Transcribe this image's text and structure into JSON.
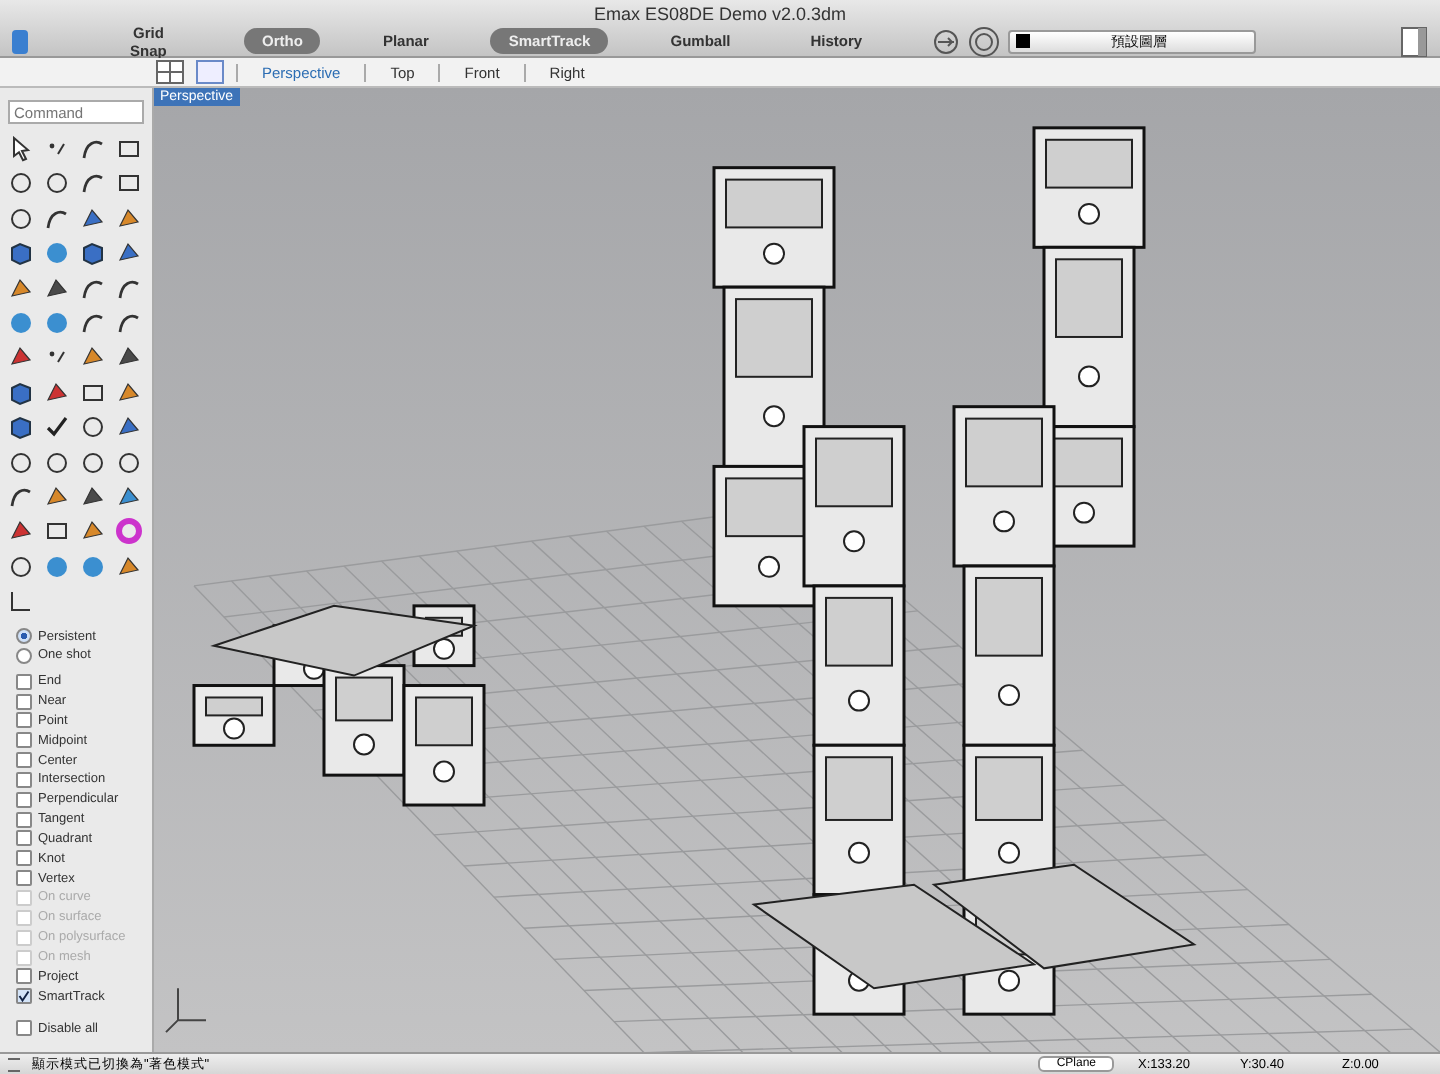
{
  "window": {
    "title": "Emax ES08DE Demo v2.0.3dm"
  },
  "toolbar": {
    "toggles": [
      {
        "label": "Grid Snap",
        "selected": false
      },
      {
        "label": "Ortho",
        "selected": true
      },
      {
        "label": "Planar",
        "selected": false
      },
      {
        "label": "SmartTrack",
        "selected": true
      },
      {
        "label": "Gumball",
        "selected": false
      },
      {
        "label": "History",
        "selected": false
      }
    ],
    "layer": "預設圖層"
  },
  "viewport_tabs": [
    {
      "label": "Perspective",
      "selected": true
    },
    {
      "label": "Top",
      "selected": false
    },
    {
      "label": "Front",
      "selected": false
    },
    {
      "label": "Right",
      "selected": false
    }
  ],
  "viewport": {
    "label": "Perspective"
  },
  "command": {
    "placeholder": "Command"
  },
  "osnap_mode": [
    {
      "label": "Persistent",
      "selected": true
    },
    {
      "label": "One shot",
      "selected": false
    }
  ],
  "osnaps": [
    {
      "label": "End",
      "checked": false,
      "disabled": false
    },
    {
      "label": "Near",
      "checked": false,
      "disabled": false
    },
    {
      "label": "Point",
      "checked": false,
      "disabled": false
    },
    {
      "label": "Midpoint",
      "checked": false,
      "disabled": false
    },
    {
      "label": "Center",
      "checked": false,
      "disabled": false
    },
    {
      "label": "Intersection",
      "checked": false,
      "disabled": false
    },
    {
      "label": "Perpendicular",
      "checked": false,
      "disabled": false
    },
    {
      "label": "Tangent",
      "checked": false,
      "disabled": false
    },
    {
      "label": "Quadrant",
      "checked": false,
      "disabled": false
    },
    {
      "label": "Knot",
      "checked": false,
      "disabled": false
    },
    {
      "label": "Vertex",
      "checked": false,
      "disabled": false
    },
    {
      "label": "On curve",
      "checked": false,
      "disabled": true
    },
    {
      "label": "On surface",
      "checked": false,
      "disabled": true
    },
    {
      "label": "On polysurface",
      "checked": false,
      "disabled": true
    },
    {
      "label": "On mesh",
      "checked": false,
      "disabled": true
    },
    {
      "label": "Project",
      "checked": false,
      "disabled": false
    },
    {
      "label": "SmartTrack",
      "checked": true,
      "disabled": false
    }
  ],
  "disable_all": {
    "label": "Disable all",
    "checked": false
  },
  "status_bar": {
    "message": "顯示模式已切換為\"著色模式\"",
    "cplane": "CPlane",
    "x": "X:133.20",
    "y": "Y:30.40",
    "z": "Z:0.00"
  }
}
